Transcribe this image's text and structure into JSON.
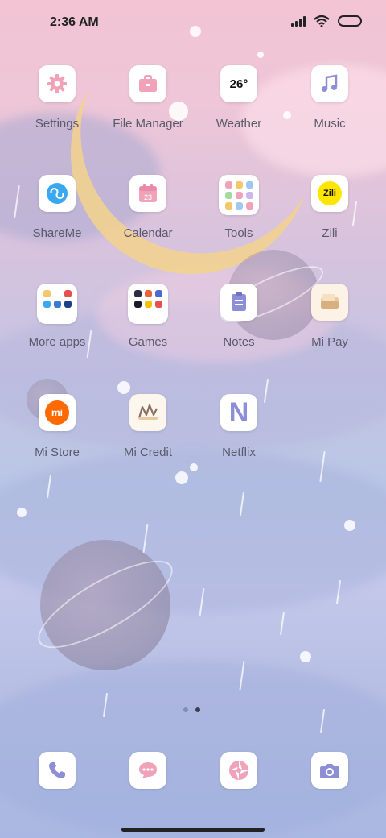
{
  "status_bar": {
    "time": "2:36 AM"
  },
  "apps": {
    "settings": {
      "label": "Settings"
    },
    "file_manager": {
      "label": "File Manager"
    },
    "weather": {
      "label": "Weather",
      "temp": "26°"
    },
    "music": {
      "label": "Music"
    },
    "shareme": {
      "label": "ShareMe"
    },
    "calendar": {
      "label": "Calendar",
      "day": "23"
    },
    "tools": {
      "label": "Tools"
    },
    "zili": {
      "label": "Zili",
      "icon_text": "Zili"
    },
    "more_apps": {
      "label": "More apps"
    },
    "games": {
      "label": "Games"
    },
    "notes": {
      "label": "Notes"
    },
    "mi_pay": {
      "label": "Mi Pay"
    },
    "mi_store": {
      "label": "Mi Store",
      "icon_text": "mi"
    },
    "mi_credit": {
      "label": "Mi Credit"
    },
    "netflix": {
      "label": "Netflix",
      "icon_text": "N"
    }
  },
  "dock": [
    "phone",
    "messages",
    "browser",
    "camera"
  ],
  "pager": {
    "pages": 2,
    "current": 2
  },
  "colors": {
    "icon_accent": "#f0a3b8",
    "icon_purple": "#8c8fd6",
    "mi_orange": "#ff6a00",
    "zili_yellow": "#ffe600"
  }
}
